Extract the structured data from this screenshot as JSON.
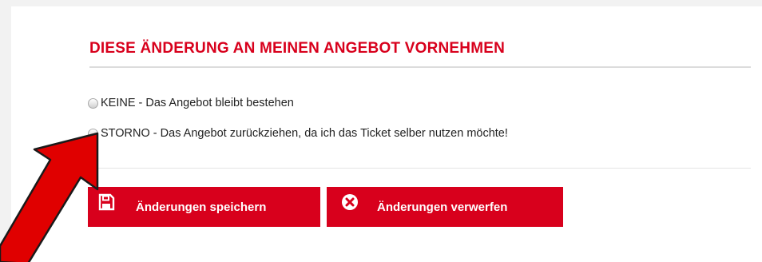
{
  "section": {
    "title": "DIESE ÄNDERUNG AN MEINEN ANGEBOT VORNEHMEN"
  },
  "options": [
    {
      "label": "KEINE - Das Angebot bleibt bestehen",
      "selected": false
    },
    {
      "label": "STORNO - Das Angebot zurückziehen, da ich das Ticket selber nutzen möchte!",
      "selected": false
    }
  ],
  "buttons": {
    "save_label": "Änderungen speichern",
    "save_icon": "save-icon",
    "discard_label": "Änderungen verwerfen",
    "discard_icon": "times-circle-icon"
  },
  "colors": {
    "accent": "#d8001c",
    "annotation_arrow": "#e00000"
  }
}
